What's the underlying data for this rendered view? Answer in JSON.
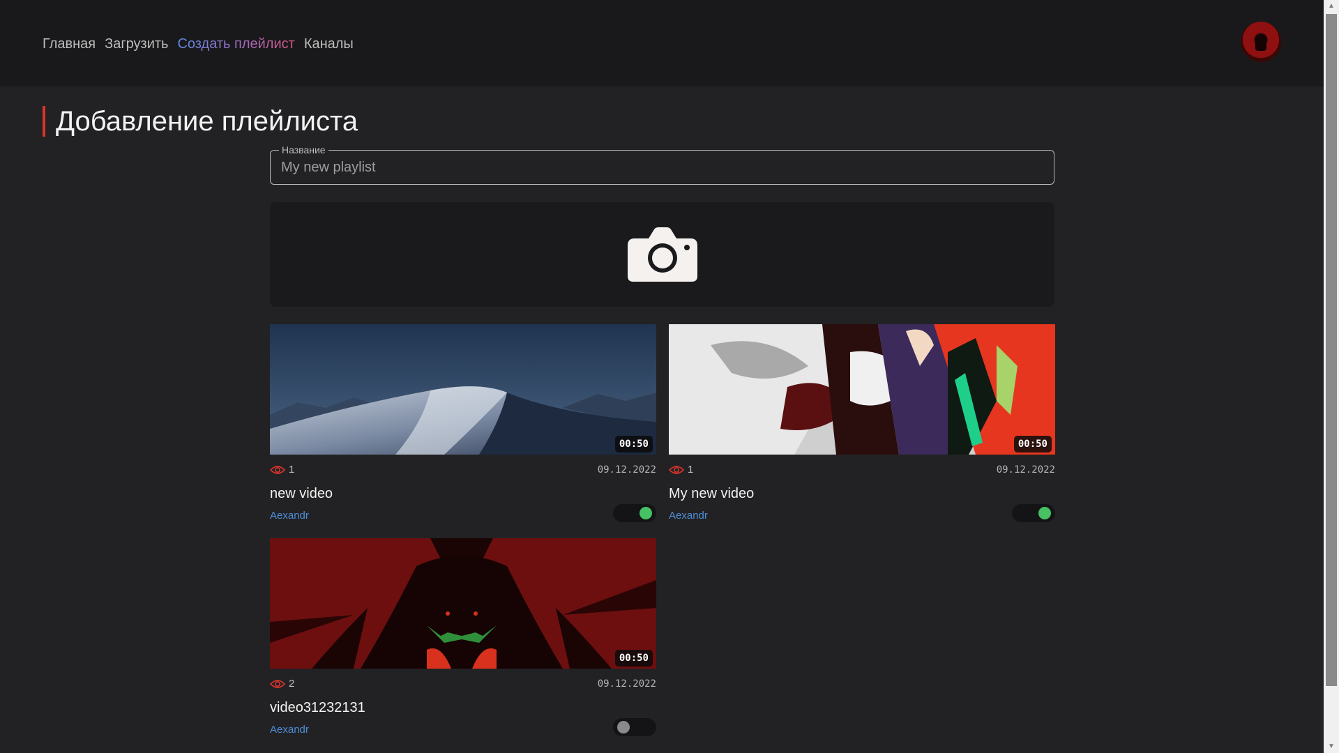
{
  "nav": {
    "items": [
      {
        "label": "Главная",
        "active": false
      },
      {
        "label": "Загрузить",
        "active": false
      },
      {
        "label": "Создать плейлист",
        "active": true
      },
      {
        "label": "Каналы",
        "active": false
      }
    ]
  },
  "page": {
    "title": "Добавление плейлиста"
  },
  "form": {
    "name_label": "Название",
    "name_placeholder": "My new playlist",
    "name_value": ""
  },
  "cover": {
    "icon": "camera-icon"
  },
  "videos": [
    {
      "title": "new video",
      "author": "Aexandr",
      "views": "1",
      "date": "09.12.2022",
      "duration": "00:50",
      "selected": true
    },
    {
      "title": "My new video",
      "author": "Aexandr",
      "views": "1",
      "date": "09.12.2022",
      "duration": "00:50",
      "selected": true
    },
    {
      "title": "video31232131",
      "author": "Aexandr",
      "views": "2",
      "date": "09.12.2022",
      "duration": "00:50",
      "selected": false
    }
  ],
  "colors": {
    "background": "#222224",
    "header": "#19191b",
    "accent_red": "#d9342b",
    "link_blue": "#4f8ed8",
    "toggle_on": "#46c163",
    "toggle_off": "#8a8a8a"
  }
}
